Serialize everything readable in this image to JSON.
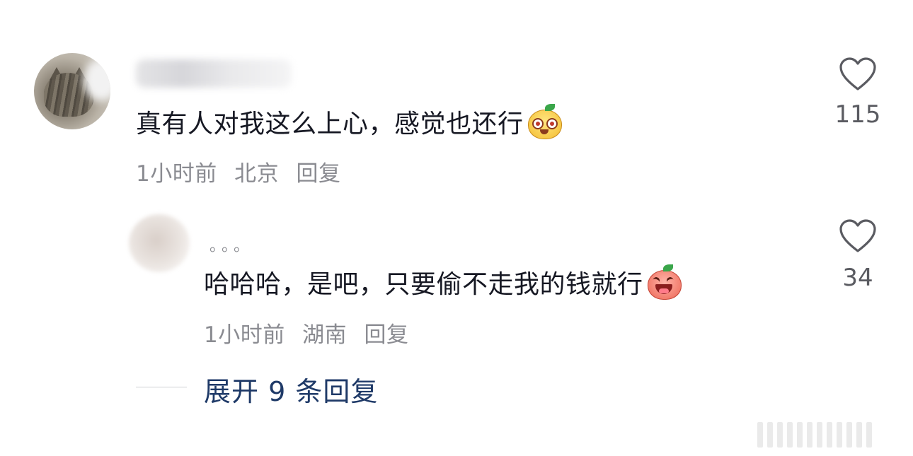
{
  "comment": {
    "text": "真有人对我这么上心，感觉也还行",
    "emoji": "yellow-face-emoji",
    "time": "1小时前",
    "location": "北京",
    "reply_label": "回复",
    "likes": "115"
  },
  "reply": {
    "username": "。。。",
    "text": "哈哈哈，是吧，只要偷不走我的钱就行",
    "emoji": "laughing-pink-face-emoji",
    "time": "1小时前",
    "location": "湖南",
    "reply_label": "回复",
    "likes": "34"
  },
  "expand": {
    "label": "展开 9 条回复"
  },
  "colors": {
    "text": "#161823",
    "meta": "#8a8b91",
    "link": "#1f3a68"
  }
}
